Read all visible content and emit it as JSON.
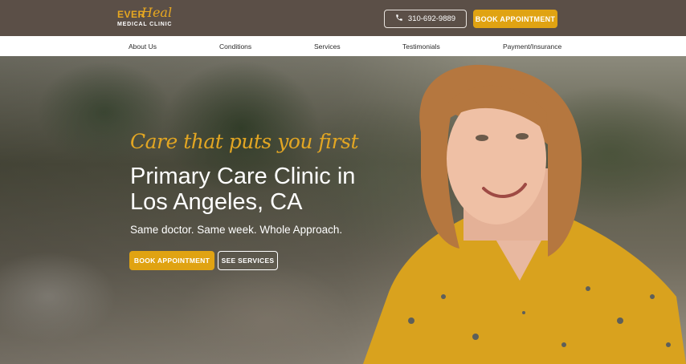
{
  "header": {
    "logo": {
      "ever": "EVER",
      "heal": "Heal",
      "subtitle": "MEDICAL CLINIC"
    },
    "phone": {
      "icon": "phone-icon",
      "number": "310-692-9889"
    },
    "cta_label": "BOOK APPOINTMENT"
  },
  "nav": {
    "items": [
      {
        "label": "About Us"
      },
      {
        "label": "Conditions"
      },
      {
        "label": "Services"
      },
      {
        "label": "Testimonials"
      },
      {
        "label": "Payment/Insurance"
      }
    ]
  },
  "hero": {
    "tagline": "Care that puts you first",
    "headline": "Primary Care Clinic in Los Angeles, CA",
    "subhead": "Same doctor. Same week. Whole Approach.",
    "primary_button": "BOOK APPOINTMENT",
    "secondary_button": "SEE SERVICES"
  },
  "colors": {
    "brand_gold": "#e0a312",
    "header_bg": "#5b4f47"
  }
}
